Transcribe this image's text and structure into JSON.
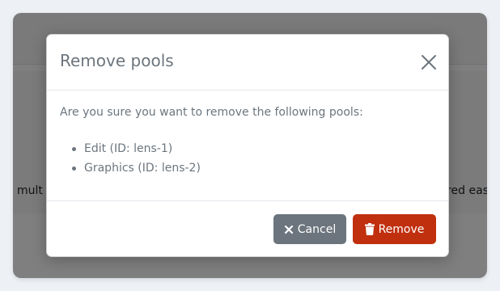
{
  "background": {
    "band_text_left": "o mult",
    "band_text_right": "red eas",
    "bottom_text_1": "",
    "bottom_text_2": ""
  },
  "modal": {
    "title": "Remove pools",
    "prompt": "Are you sure you want to remove the following pools:",
    "pools": [
      "Edit (ID: lens-1)",
      "Graphics (ID: lens-2)"
    ],
    "close_icon": "close-icon",
    "cancel_label": "Cancel",
    "cancel_icon": "times-icon",
    "remove_label": "Remove",
    "remove_icon": "trash-icon"
  },
  "colors": {
    "cancel_button": "#6c757d",
    "remove_button": "#c0300e",
    "text_muted": "#6c757d"
  }
}
